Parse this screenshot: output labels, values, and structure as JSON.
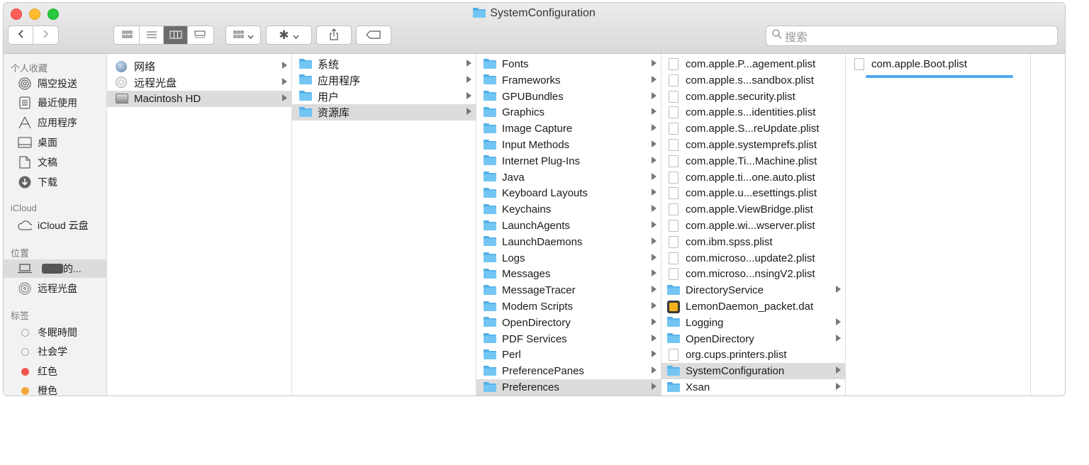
{
  "window": {
    "title": "SystemConfiguration"
  },
  "toolbar": {
    "back_icon": "chevron-left-icon",
    "forward_icon": "chevron-right-icon",
    "view_modes": [
      "icon-view-icon",
      "list-view-icon",
      "column-view-icon",
      "gallery-view-icon"
    ],
    "search_placeholder": "搜索"
  },
  "sidebar": {
    "favorites_header": "个人收藏",
    "favorites": [
      {
        "label": "隔空投送",
        "icon": "airdrop-icon"
      },
      {
        "label": "最近使用",
        "icon": "recents-icon"
      },
      {
        "label": "应用程序",
        "icon": "applications-icon"
      },
      {
        "label": "桌面",
        "icon": "desktop-icon"
      },
      {
        "label": "文稿",
        "icon": "documents-icon"
      },
      {
        "label": "下载",
        "icon": "downloads-icon"
      }
    ],
    "icloud_header": "iCloud",
    "icloud": [
      {
        "label": "iCloud 云盘",
        "icon": "cloud-icon"
      }
    ],
    "locations_header": "位置",
    "locations": [
      {
        "label": "的...",
        "icon": "laptop-icon"
      },
      {
        "label": "远程光盘",
        "icon": "disc-icon"
      }
    ],
    "tags_header": "标签",
    "tags": [
      {
        "label": "冬眠時間",
        "color": "#ffffff"
      },
      {
        "label": "社会学",
        "color": "#ffffff"
      },
      {
        "label": "红色",
        "color": "#f0564f"
      },
      {
        "label": "橙色",
        "color": "#f4a73b"
      }
    ]
  },
  "columns": {
    "col1": [
      {
        "label": "网络",
        "icon": "network-globe-icon",
        "arrow": true
      },
      {
        "label": "远程光盘",
        "icon": "remote-disc-icon",
        "arrow": true
      },
      {
        "label": "Macintosh HD",
        "icon": "hard-drive-icon",
        "arrow": true,
        "selected": true
      }
    ],
    "col2": [
      {
        "label": "系统",
        "arrow": true
      },
      {
        "label": "应用程序",
        "arrow": true
      },
      {
        "label": "用户",
        "arrow": true
      },
      {
        "label": "资源库",
        "arrow": true,
        "selected": true
      }
    ],
    "col3": [
      {
        "label": "Fonts",
        "arrow": true
      },
      {
        "label": "Frameworks",
        "arrow": true
      },
      {
        "label": "GPUBundles",
        "arrow": true
      },
      {
        "label": "Graphics",
        "arrow": true
      },
      {
        "label": "Image Capture",
        "arrow": true
      },
      {
        "label": "Input Methods",
        "arrow": true
      },
      {
        "label": "Internet Plug-Ins",
        "arrow": true
      },
      {
        "label": "Java",
        "arrow": true
      },
      {
        "label": "Keyboard Layouts",
        "arrow": true
      },
      {
        "label": "Keychains",
        "arrow": true
      },
      {
        "label": "LaunchAgents",
        "arrow": true
      },
      {
        "label": "LaunchDaemons",
        "arrow": true
      },
      {
        "label": "Logs",
        "arrow": true
      },
      {
        "label": "Messages",
        "arrow": true
      },
      {
        "label": "MessageTracer",
        "arrow": true
      },
      {
        "label": "Modem Scripts",
        "arrow": true
      },
      {
        "label": "OpenDirectory",
        "arrow": true
      },
      {
        "label": "PDF Services",
        "arrow": true
      },
      {
        "label": "Perl",
        "arrow": true
      },
      {
        "label": "PreferencePanes",
        "arrow": true
      },
      {
        "label": "Preferences",
        "arrow": true,
        "selected": true
      }
    ],
    "col4": [
      {
        "label": "com.apple.P...agement.plist",
        "kind": "file"
      },
      {
        "label": "com.apple.s...sandbox.plist",
        "kind": "file"
      },
      {
        "label": "com.apple.security.plist",
        "kind": "file"
      },
      {
        "label": "com.apple.s...identities.plist",
        "kind": "file"
      },
      {
        "label": "com.apple.S...reUpdate.plist",
        "kind": "file"
      },
      {
        "label": "com.apple.systemprefs.plist",
        "kind": "file"
      },
      {
        "label": "com.apple.Ti...Machine.plist",
        "kind": "file"
      },
      {
        "label": "com.apple.ti...one.auto.plist",
        "kind": "file"
      },
      {
        "label": "com.apple.u...esettings.plist",
        "kind": "file"
      },
      {
        "label": "com.apple.ViewBridge.plist",
        "kind": "file"
      },
      {
        "label": "com.apple.wi...wserver.plist",
        "kind": "file"
      },
      {
        "label": "com.ibm.spss.plist",
        "kind": "file"
      },
      {
        "label": "com.microso...update2.plist",
        "kind": "file"
      },
      {
        "label": "com.microso...nsingV2.plist",
        "kind": "file"
      },
      {
        "label": "DirectoryService",
        "kind": "folder",
        "arrow": true
      },
      {
        "label": "LemonDaemon_packet.dat",
        "kind": "lemon"
      },
      {
        "label": "Logging",
        "kind": "folder",
        "arrow": true
      },
      {
        "label": "OpenDirectory",
        "kind": "folder",
        "arrow": true
      },
      {
        "label": "org.cups.printers.plist",
        "kind": "file"
      },
      {
        "label": "SystemConfiguration",
        "kind": "folder",
        "arrow": true,
        "selected": true
      },
      {
        "label": "Xsan",
        "kind": "folder",
        "arrow": true
      }
    ],
    "col5": [
      {
        "label": "com.apple.Boot.plist",
        "kind": "file"
      }
    ]
  }
}
